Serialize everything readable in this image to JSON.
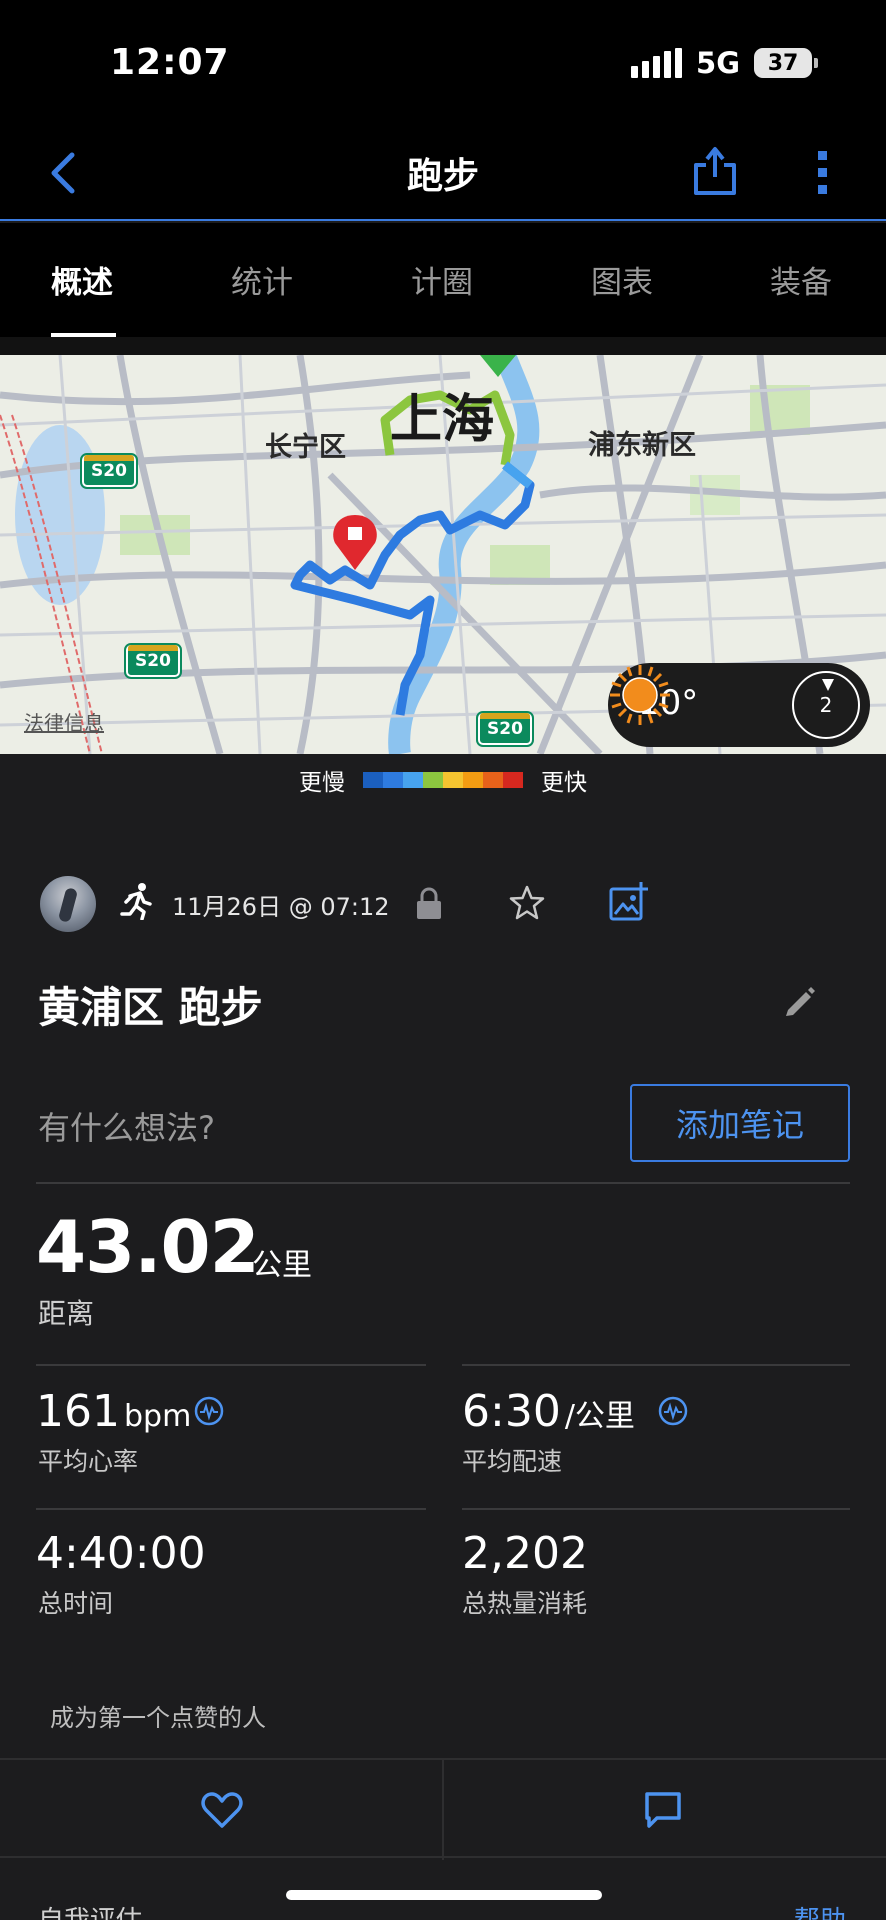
{
  "status_bar": {
    "time": "12:07",
    "network": "5G",
    "battery": "37"
  },
  "nav": {
    "title": "跑步",
    "back_icon": "chevron-left-icon",
    "share_icon": "share-icon",
    "more_icon": "more-vertical-icon"
  },
  "tabs": [
    "概述",
    "统计",
    "计圈",
    "图表",
    "装备"
  ],
  "active_tab": 0,
  "map": {
    "labels": {
      "changning": "长宁区",
      "shanghai": "上海",
      "pudong": "浦东新区"
    },
    "highway_shield": "S20",
    "legal_link": "法律信息",
    "weather": {
      "temperature": "10°",
      "condition_icon": "sun-icon",
      "wind": "2"
    }
  },
  "pace_legend": {
    "slow": "更慢",
    "fast": "更快",
    "colors": [
      "#1b5fbf",
      "#2e7be0",
      "#47a3ef",
      "#8cc63f",
      "#f4c430",
      "#f39c12",
      "#e8621a",
      "#d6281f"
    ]
  },
  "activity": {
    "datetime": "11月26日 @ 07:12",
    "title": "黄浦区 跑步",
    "thoughts_placeholder": "有什么想法?",
    "add_note": "添加笔记"
  },
  "stats": {
    "distance": {
      "value": "43.02",
      "unit": "公里",
      "label": "距离"
    },
    "avg_hr": {
      "value": "161",
      "unit": "bpm",
      "label": "平均心率"
    },
    "avg_pace": {
      "value": "6:30",
      "unit": "/公里",
      "label": "平均配速"
    },
    "total_time": {
      "value": "4:40:00",
      "label": "总时间"
    },
    "calories": {
      "value": "2,202",
      "label": "总热量消耗"
    }
  },
  "social": {
    "likes_text": "成为第一个点赞的人"
  },
  "footer": {
    "self_eval": "自我评估",
    "help": "帮助"
  },
  "accent_color": "#3a7be0"
}
